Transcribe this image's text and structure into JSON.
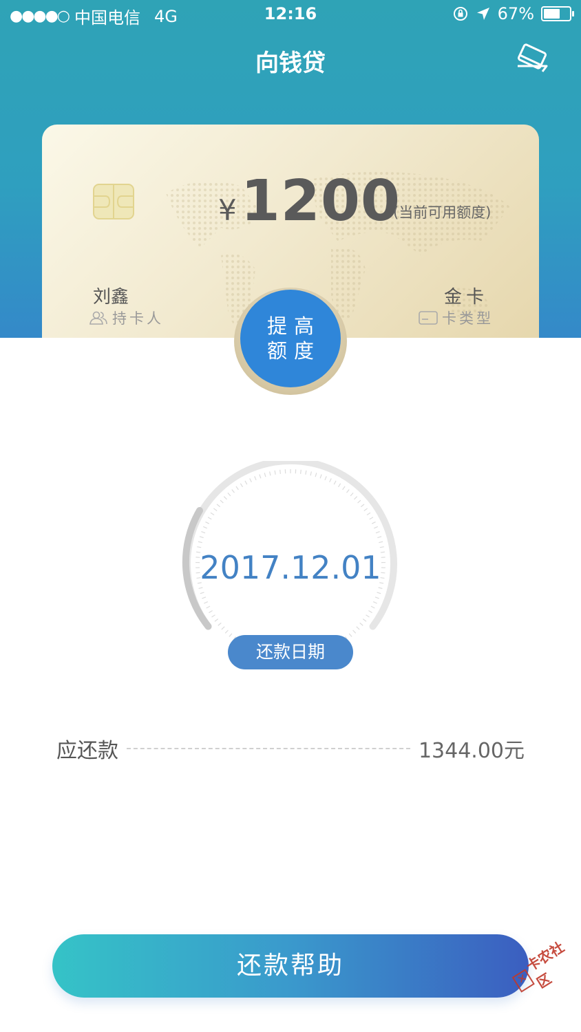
{
  "status_bar": {
    "signal": "●●●●○",
    "carrier": "中国电信",
    "network": "4G",
    "time": "12:16",
    "battery": "67%",
    "battery_level": 0.67
  },
  "nav": {
    "title": "向钱贷",
    "right_icon": "card-switch-icon"
  },
  "card": {
    "currency": "¥",
    "amount": "1200",
    "amount_caption": "(当前可用额度)",
    "holder_name": "刘鑫",
    "holder_label": "持卡人",
    "card_type": "金卡",
    "card_type_label": "卡类型"
  },
  "raise_limit": {
    "line1": "提高",
    "line2": "额度"
  },
  "repayment": {
    "due_date": "2017.12.01",
    "due_label": "还款日期",
    "amount_label": "应还款",
    "amount_value": "1344.00元"
  },
  "help_button": {
    "label": "还款帮助"
  },
  "watermark": {
    "text": "卡农社区"
  },
  "colors": {
    "header_top": "#2fa3b6",
    "accent_blue": "#2f86d9",
    "date_blue": "#4382c4"
  }
}
